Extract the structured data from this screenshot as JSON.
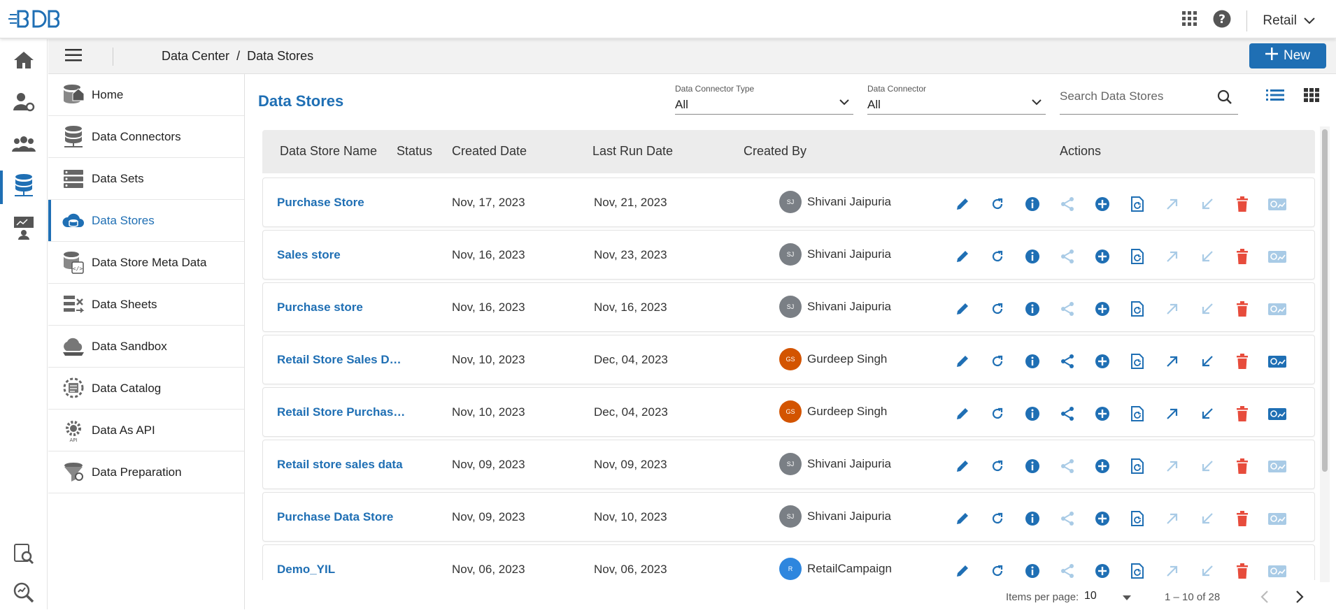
{
  "app": {
    "workspace": "Retail"
  },
  "breadcrumb": {
    "items": [
      "Data Center",
      "/",
      "Data Stores"
    ]
  },
  "toolbar": {
    "new_label": "New"
  },
  "subnav": {
    "items": [
      {
        "label": "Home",
        "icon": "database-home-icon"
      },
      {
        "label": "Data Connectors",
        "icon": "data-connector-icon"
      },
      {
        "label": "Data Sets",
        "icon": "data-sets-icon"
      },
      {
        "label": "Data Stores",
        "icon": "cloud-database-icon",
        "active": true
      },
      {
        "label": "Data Store Meta Data",
        "icon": "meta-data-icon"
      },
      {
        "label": "Data Sheets",
        "icon": "data-sheets-icon"
      },
      {
        "label": "Data Sandbox",
        "icon": "sandbox-icon"
      },
      {
        "label": "Data Catalog",
        "icon": "catalog-icon"
      },
      {
        "label": "Data As API",
        "icon": "api-gear-icon"
      },
      {
        "label": "Data Preparation",
        "icon": "preparation-icon"
      }
    ]
  },
  "main": {
    "title": "Data Stores",
    "filters": {
      "connector_type": {
        "label": "Data Connector Type",
        "value": "All"
      },
      "connector": {
        "label": "Data Connector",
        "value": "All"
      }
    },
    "search": {
      "placeholder": "Search Data Stores"
    }
  },
  "table": {
    "columns": [
      "Data Store Name",
      "Status",
      "Created Date",
      "Last Run Date",
      "Created By",
      "Actions"
    ],
    "rows": [
      {
        "name": "Purchase Store",
        "created": "Nov, 17, 2023",
        "last_run": "Nov, 21, 2023",
        "initials": "SJ",
        "creator": "Shivani Jaipuria",
        "avatar_color": "#7a7f85",
        "shared": false
      },
      {
        "name": "Sales store",
        "created": "Nov, 16, 2023",
        "last_run": "Nov, 23, 2023",
        "initials": "SJ",
        "creator": "Shivani Jaipuria",
        "avatar_color": "#7a7f85",
        "shared": false
      },
      {
        "name": "Purchase store",
        "created": "Nov, 16, 2023",
        "last_run": "Nov, 16, 2023",
        "initials": "SJ",
        "creator": "Shivani Jaipuria",
        "avatar_color": "#7a7f85",
        "shared": false
      },
      {
        "name": "Retail Store Sales Data",
        "created": "Nov, 10, 2023",
        "last_run": "Dec, 04, 2023",
        "initials": "GS",
        "creator": "Gurdeep Singh",
        "avatar_color": "#d35400",
        "shared": true
      },
      {
        "name": "Retail Store Purchase...",
        "created": "Nov, 10, 2023",
        "last_run": "Dec, 04, 2023",
        "initials": "GS",
        "creator": "Gurdeep Singh",
        "avatar_color": "#d35400",
        "shared": true
      },
      {
        "name": "Retail store sales data",
        "created": "Nov, 09, 2023",
        "last_run": "Nov, 09, 2023",
        "initials": "SJ",
        "creator": "Shivani Jaipuria",
        "avatar_color": "#7a7f85",
        "shared": false
      },
      {
        "name": "Purchase Data Store",
        "created": "Nov, 09, 2023",
        "last_run": "Nov, 10, 2023",
        "initials": "SJ",
        "creator": "Shivani Jaipuria",
        "avatar_color": "#7a7f85",
        "shared": false
      },
      {
        "name": "Demo_YIL",
        "created": "Nov, 06, 2023",
        "last_run": "Nov, 06, 2023",
        "initials": "R",
        "creator": "RetailCampaign",
        "avatar_color": "#2e86de",
        "shared": false
      }
    ]
  },
  "pagination": {
    "items_per_page_label": "Items per page:",
    "items_per_page": "10",
    "range": "1 – 10 of 28"
  },
  "colors": {
    "accent": "#1f6fb4",
    "danger": "#e74c3c",
    "disabled": "#a9cbe6"
  }
}
